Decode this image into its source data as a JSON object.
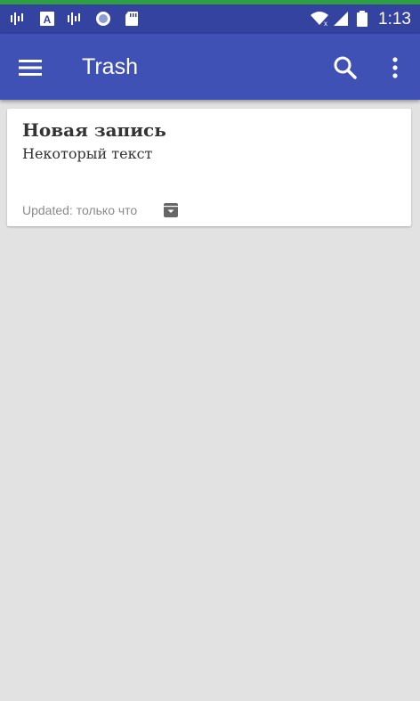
{
  "status_bar": {
    "time": "1:13",
    "left_icons": [
      "signal-app-icon",
      "text-a-icon",
      "signal-app-icon",
      "circle-app-icon",
      "sd-card-icon"
    ],
    "right_icons": [
      "wifi-icon",
      "cell-signal-icon",
      "battery-icon"
    ],
    "color": "#3442a0",
    "top_accent_color": "#2ea043"
  },
  "app_bar": {
    "title": "Trash",
    "color": "#3f51b5",
    "nav_icon": "menu-icon",
    "actions": [
      "search-icon",
      "more-vert-icon"
    ]
  },
  "notes": [
    {
      "title": "Новая запись",
      "body": "Некоторый текст",
      "updated": "Updated: только что",
      "action_icon": "archive-icon"
    }
  ],
  "colors": {
    "background": "#e2e2e2",
    "card": "#ffffff",
    "meta_text": "#8a8a8a"
  }
}
